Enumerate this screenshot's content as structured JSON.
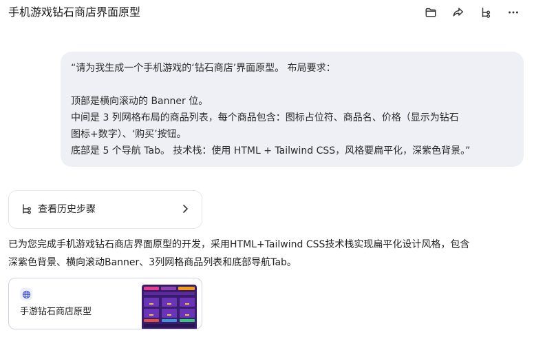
{
  "header": {
    "title": "手机游戏钻石商店界面原型",
    "icons": [
      "folder-icon",
      "share-icon",
      "branch-icon",
      "more-icon"
    ]
  },
  "user_message": {
    "lines": [
      "“请为我生成一个手机游戏的‘钻石商店’界面原型。 布局要求：",
      "",
      "顶部是横向滚动的 Banner 位。",
      "中间是 3 列网格布局的商品列表，每个商品包含：图标占位符、商品名、价格（显示为钻石",
      "图标+数字）、‘购买’按钮。",
      "底部是 5 个导航 Tab。 技术栈：使用 HTML + Tailwind CSS，风格要扁平化，深紫色背景。”"
    ]
  },
  "history": {
    "label": "查看历史步骤"
  },
  "response": {
    "lines": [
      "已为您完成手机游戏钻石商店界面原型的开发，采用HTML+Tailwind CSS技术栈实现扁平化设计风格，包含",
      "深紫色背景、横向滚动Banner、3列网格商品列表和底部导航Tab。"
    ]
  },
  "artifact": {
    "label": "手游钻石商店原型",
    "icon": "globe-icon"
  },
  "colors": {
    "bubble_bg": "#eef0f6",
    "artifact_border": "#cfd2f0",
    "thumb_bg": "#3b1d6e",
    "thumb_cell": "#6a34b8"
  }
}
